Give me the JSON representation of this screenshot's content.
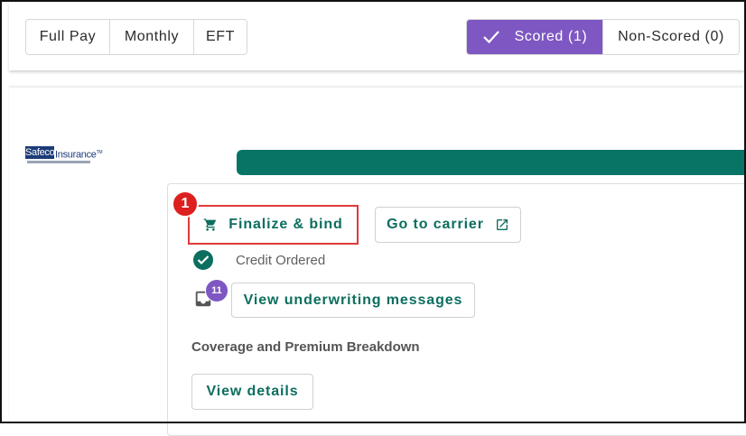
{
  "payment_filters": [
    "Full Pay",
    "Monthly",
    "EFT"
  ],
  "score_tabs": {
    "scored": "Scored (1)",
    "non_scored": "Non-Scored (0)"
  },
  "carrier": {
    "logo_text_box": "Safeco",
    "logo_text": "Insurance",
    "logo_tm": "TM"
  },
  "actions": {
    "step_number": "1",
    "finalize_label": "Finalize & bind",
    "go_to_carrier_label": "Go to carrier"
  },
  "status": {
    "credit_label": "Credit Ordered"
  },
  "messages": {
    "count": "11",
    "view_label": "View underwriting messages"
  },
  "coverage": {
    "heading": "Coverage and Premium Breakdown",
    "view_details_label": "View details"
  },
  "colors": {
    "accent_purple": "#7e57c2",
    "brand_green": "#077466",
    "highlight_red": "#e03a3a"
  }
}
